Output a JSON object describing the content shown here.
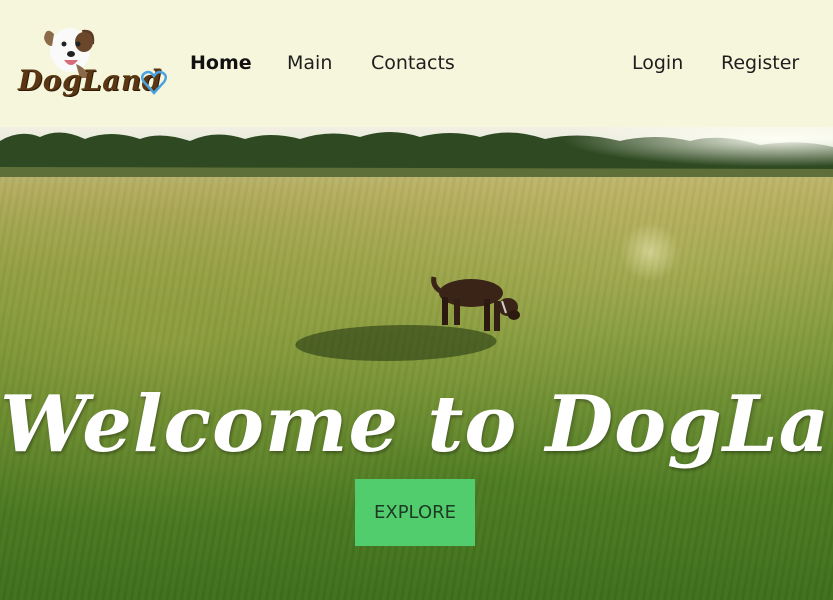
{
  "brand": {
    "logo_text": "DogLand",
    "logo_icon": "dog-face-icon",
    "heart_icon": "heart-icon",
    "heart_color": "#4aa3e0",
    "text_color": "#5a3712"
  },
  "nav": {
    "home": "Home",
    "main": "Main",
    "contacts": "Contacts",
    "login": "Login",
    "register": "Register"
  },
  "hero": {
    "title": "Welcome to DogLand",
    "cta_label": "EXPLORE",
    "cta_color": "#52cd6e"
  },
  "colors": {
    "navbar_bg": "#f6f6dc"
  }
}
